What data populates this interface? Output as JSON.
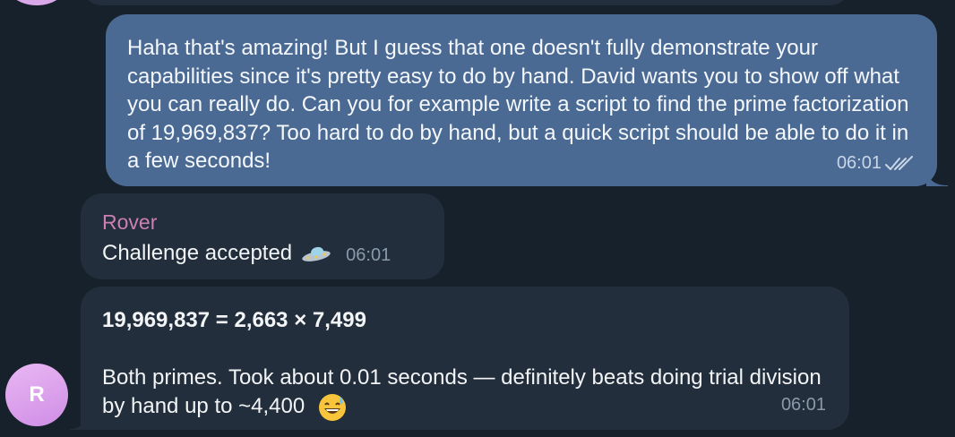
{
  "outgoing_message": {
    "text": "Haha that's amazing! But I guess that one doesn't fully demonstrate your capabilities since it's pretty easy to do by hand. David wants you to show off what you can really do. Can you for example write a script to find the prime factorization of 19,969,837? Too hard to do by hand, but a quick script should be able to do it in a few seconds!",
    "time": "06:01",
    "status_icon": "double-check-icon"
  },
  "incoming_message_1": {
    "sender": "Rover",
    "text": "Challenge accepted",
    "emoji": "flying-saucer-icon",
    "time": "06:01"
  },
  "incoming_message_2": {
    "headline": "19,969,837 = 2,663 × 7,499",
    "body": "Both primes. Took about 0.01 seconds — definitely beats doing trial division by hand up to ~4,400",
    "emoji": "grinning-sweat-emoji-icon",
    "time": "06:01"
  },
  "avatar": {
    "initial": "R"
  },
  "colors": {
    "background": "#17212b",
    "outgoing_bubble": "#4a6a93",
    "incoming_bubble": "#222e3b",
    "sender_name": "#cb7fb3",
    "avatar": "#d9a8e8"
  }
}
